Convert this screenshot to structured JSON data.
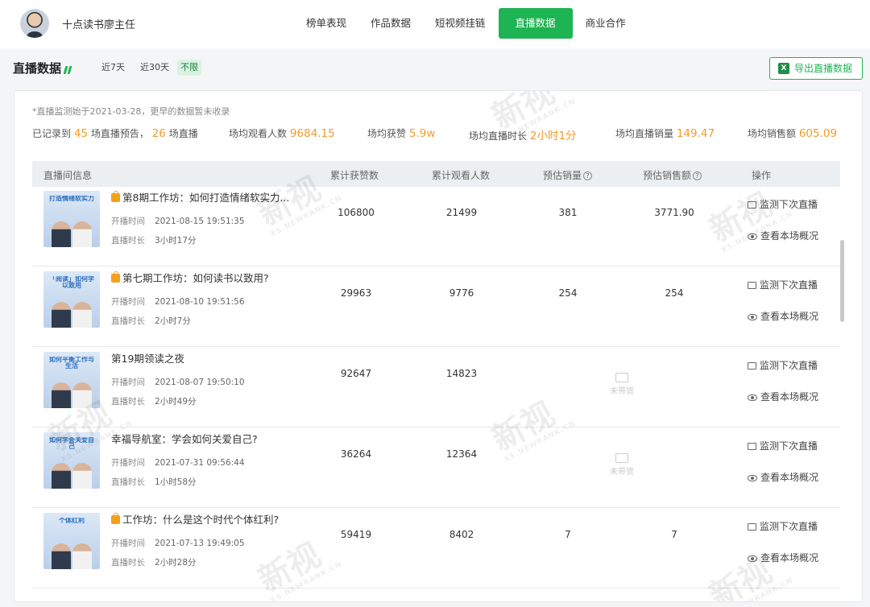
{
  "user": {
    "name": "十点读书廖主任"
  },
  "nav": [
    {
      "label": "榜单表现",
      "active": false
    },
    {
      "label": "作品数据",
      "active": false
    },
    {
      "label": "短视频挂链",
      "active": false
    },
    {
      "label": "直播数据",
      "active": true
    },
    {
      "label": "商业合作",
      "active": false
    }
  ],
  "section": {
    "title": "直播数据",
    "ranges": [
      {
        "label": "近7天",
        "active": false
      },
      {
        "label": "近30天",
        "active": false
      },
      {
        "label": "不限",
        "active": true
      }
    ],
    "export_label": "导出直播数据",
    "export_icon": "X"
  },
  "note": "*直播监测始于2021-03-28，更早的数据暂未收录",
  "stats": {
    "recorded_prefix": "已记录到",
    "preview_count": "45",
    "preview_suffix": "场直播预告，",
    "live_count": "26",
    "live_suffix": "场直播",
    "avg_viewers_label": "场均观看人数",
    "avg_viewers": "9684.15",
    "avg_likes_label": "场均获赞",
    "avg_likes": "5.9w",
    "avg_duration_label": "场均直播时长",
    "avg_duration_h": "2",
    "avg_duration_unit_h": "小时",
    "avg_duration_m": "1",
    "avg_duration_unit_m": "分",
    "avg_sales_label": "场均直播销量",
    "avg_sales": "149.47",
    "avg_revenue_label": "场均销售额",
    "avg_revenue": "605.09"
  },
  "table": {
    "headers": [
      "直播间信息",
      "累计获赞数",
      "累计观看人数",
      "预估销量",
      "预估销售额",
      "操作"
    ],
    "time_label": "开播时间",
    "duration_label": "直播时长",
    "action_monitor": "监测下次直播",
    "action_overview": "查看本场概况",
    "no_cart_label": "未带货",
    "rows": [
      {
        "title": "第8期工作坊：如何打造情绪软实力...",
        "shop": true,
        "thumb_caption": "打造情绪软实力",
        "start": "2021-08-15 19:51:35",
        "duration": "3小时17分",
        "likes": "106800",
        "viewers": "21499",
        "sales": "381",
        "revenue": "3771.90",
        "cart": true
      },
      {
        "title": "第七期工作坊：如何读书以致用?",
        "shop": true,
        "thumb_caption": "「阅读」如何学以致用",
        "start": "2021-08-10 19:51:56",
        "duration": "2小时7分",
        "likes": "29963",
        "viewers": "9776",
        "sales": "254",
        "revenue": "254",
        "cart": true
      },
      {
        "title": "第19期领读之夜",
        "shop": false,
        "thumb_caption": "如何平衡工作与生活",
        "start": "2021-08-07 19:50:10",
        "duration": "2小时49分",
        "likes": "92647",
        "viewers": "14823",
        "sales": "",
        "revenue": "",
        "cart": false
      },
      {
        "title": "幸福导航室：学会如何关爱自己?",
        "shop": false,
        "thumb_caption": "如何学会关爱自己",
        "start": "2021-07-31 09:56:44",
        "duration": "1小时58分",
        "likes": "36264",
        "viewers": "12364",
        "sales": "",
        "revenue": "",
        "cart": false
      },
      {
        "title": "工作坊：什么是这个时代个体红利?",
        "shop": true,
        "thumb_caption": "个体红利",
        "start": "2021-07-13 19:49:05",
        "duration": "2小时28分",
        "likes": "59419",
        "viewers": "8402",
        "sales": "7",
        "revenue": "7",
        "cart": true
      }
    ]
  },
  "watermark": {
    "big": "新视",
    "small": "XS.NEWRANK.CN"
  }
}
